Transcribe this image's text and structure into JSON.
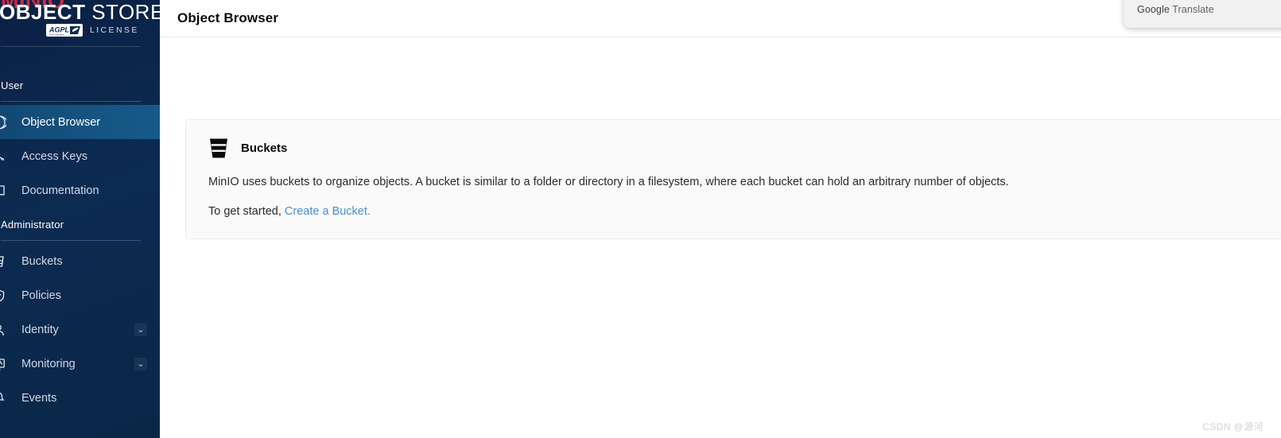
{
  "sidebar": {
    "brand": {
      "minio": "MINIO",
      "object": "OBJECT",
      "store": "STORE",
      "badge": "AGPL",
      "license": "LICENSE"
    },
    "sections": [
      {
        "label": "User"
      },
      {
        "label": "Administrator"
      }
    ],
    "user_items": [
      {
        "label": "Object Browser",
        "icon": "object-browser-icon",
        "active": true,
        "expandable": false
      },
      {
        "label": "Access Keys",
        "icon": "key-icon",
        "active": false,
        "expandable": false
      },
      {
        "label": "Documentation",
        "icon": "book-icon",
        "active": false,
        "expandable": false
      }
    ],
    "admin_items": [
      {
        "label": "Buckets",
        "icon": "bucket-icon",
        "active": false,
        "expandable": false
      },
      {
        "label": "Policies",
        "icon": "policy-icon",
        "active": false,
        "expandable": false
      },
      {
        "label": "Identity",
        "icon": "identity-icon",
        "active": false,
        "expandable": true
      },
      {
        "label": "Monitoring",
        "icon": "monitoring-icon",
        "active": false,
        "expandable": true
      },
      {
        "label": "Events",
        "icon": "events-icon",
        "active": false,
        "expandable": false
      }
    ],
    "chevron_glyph": "⌄"
  },
  "header": {
    "title": "Object Browser"
  },
  "card": {
    "icon": "bucket-icon",
    "title": "Buckets",
    "description": "MinIO uses buckets to organize objects. A bucket is similar to a folder or directory in a filesystem, where each bucket can hold an arbitrary number of objects.",
    "cta_prefix": "To get started, ",
    "cta_link": "Create a Bucket."
  },
  "translate_popup": {
    "brand": "Google",
    "label": " Translate"
  },
  "watermark": {
    "text": "CSDN @源河"
  },
  "colors": {
    "sidebar_bg": "#0c2b51",
    "sidebar_active": "#15527f",
    "accent_red": "#c72c48",
    "link_blue": "#4c8fd1",
    "card_bg": "#fafafa",
    "card_border": "#ececec"
  }
}
